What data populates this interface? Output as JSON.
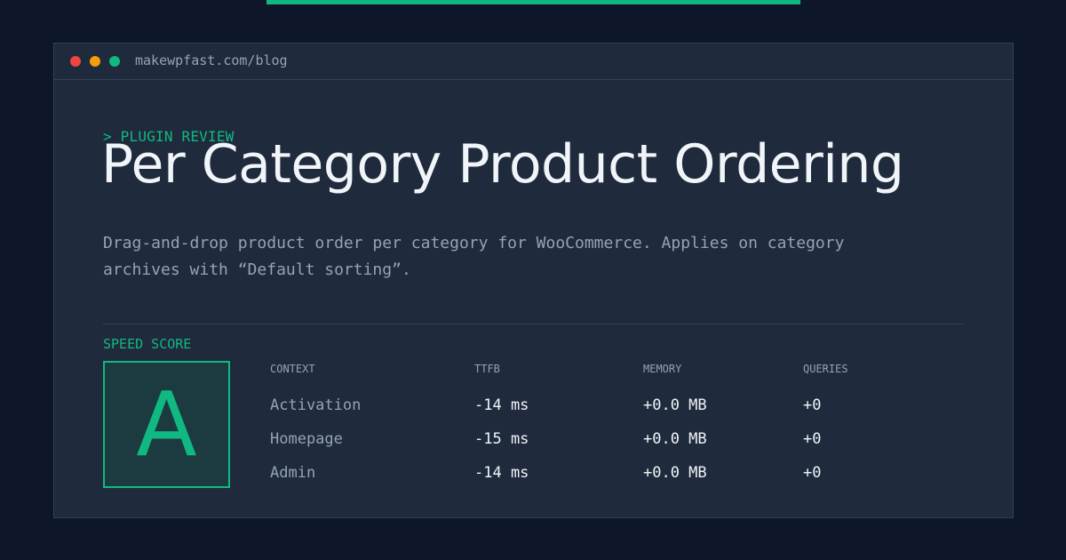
{
  "colors": {
    "background": "#0e1729",
    "panel": "#1f2a3c",
    "accent": "#10b981",
    "dot_red": "#ef4444",
    "dot_yellow": "#f59e0b",
    "dot_green": "#10b981",
    "text_primary": "#f1f5f9",
    "text_muted": "#94a3b8"
  },
  "window": {
    "url": "makewpfast.com/blog"
  },
  "header": {
    "kicker": "> PLUGIN REVIEW",
    "title": "Per Category Product Ordering",
    "description": "Drag‑and‑drop product order per category for WooCommerce. Applies on category archives with “Default sorting”."
  },
  "score": {
    "label": "SPEED SCORE",
    "grade": "A"
  },
  "metrics": {
    "columns": [
      "CONTEXT",
      "TTFB",
      "MEMORY",
      "QUERIES"
    ],
    "rows": [
      {
        "context": "Activation",
        "ttfb": "-14 ms",
        "memory": "+0.0 MB",
        "queries": "+0"
      },
      {
        "context": "Homepage",
        "ttfb": "-15 ms",
        "memory": "+0.0 MB",
        "queries": "+0"
      },
      {
        "context": "Admin",
        "ttfb": "-14 ms",
        "memory": "+0.0 MB",
        "queries": "+0"
      }
    ]
  }
}
